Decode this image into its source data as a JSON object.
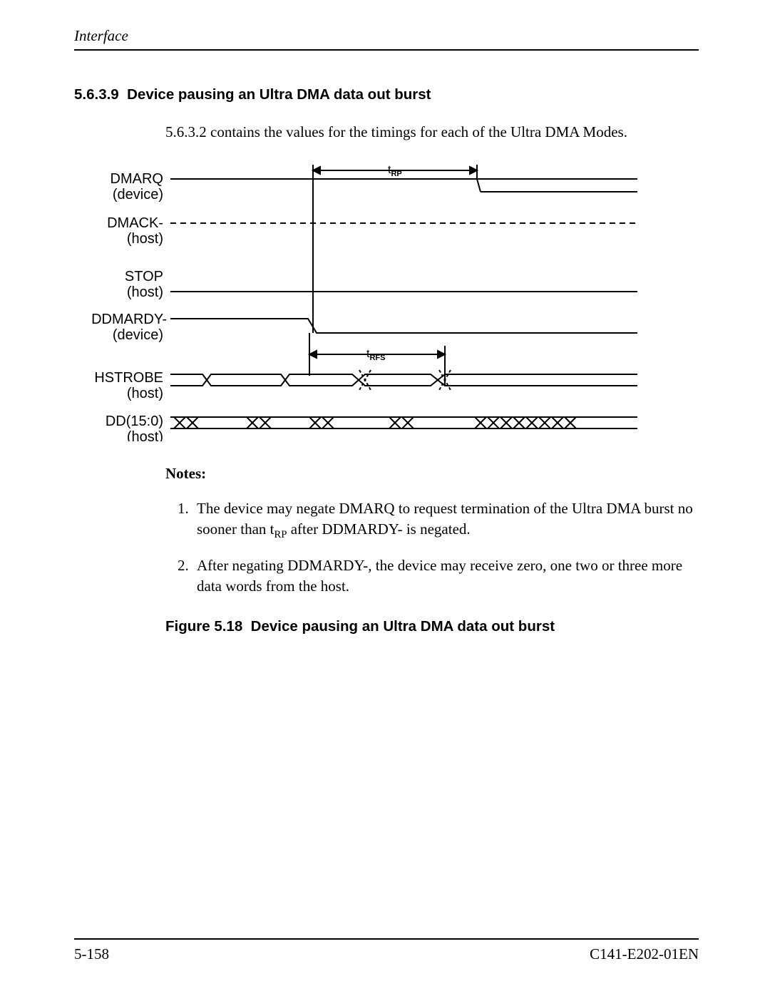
{
  "header": {
    "running_title": "Interface"
  },
  "section": {
    "number": "5.6.3.9",
    "title": "Device pausing an Ultra DMA data out burst",
    "lead": "5.6.3.2 contains the values for the timings for each of the Ultra DMA Modes."
  },
  "diagram": {
    "signals": [
      {
        "name": "DMARQ",
        "owner": "(device)"
      },
      {
        "name": "DMACK-",
        "owner": "(host)"
      },
      {
        "name": "STOP",
        "owner": "(host)"
      },
      {
        "name": "DDMARDY-",
        "owner": "(device)"
      },
      {
        "name": "HSTROBE",
        "owner": "(host)"
      },
      {
        "name": "DD(15:0)",
        "owner": "(host)"
      }
    ],
    "timings": [
      {
        "label_prefix": "t",
        "label_sub": "RP"
      },
      {
        "label_prefix": "t",
        "label_sub": "RFS"
      }
    ]
  },
  "notes": {
    "label": "Notes:",
    "items": [
      {
        "pre": "The device may negate DMARQ to request termination of the Ultra DMA burst no sooner than t",
        "sub": "RP",
        "post": " after DDMARDY- is negated."
      },
      {
        "pre": "After negating DDMARDY-, the device may receive zero, one two or three more data words from the host.",
        "sub": "",
        "post": ""
      }
    ]
  },
  "figure": {
    "label": "Figure 5.18",
    "title": "Device pausing an Ultra DMA data out burst"
  },
  "footer": {
    "page": "5-158",
    "doc": "C141-E202-01EN"
  }
}
